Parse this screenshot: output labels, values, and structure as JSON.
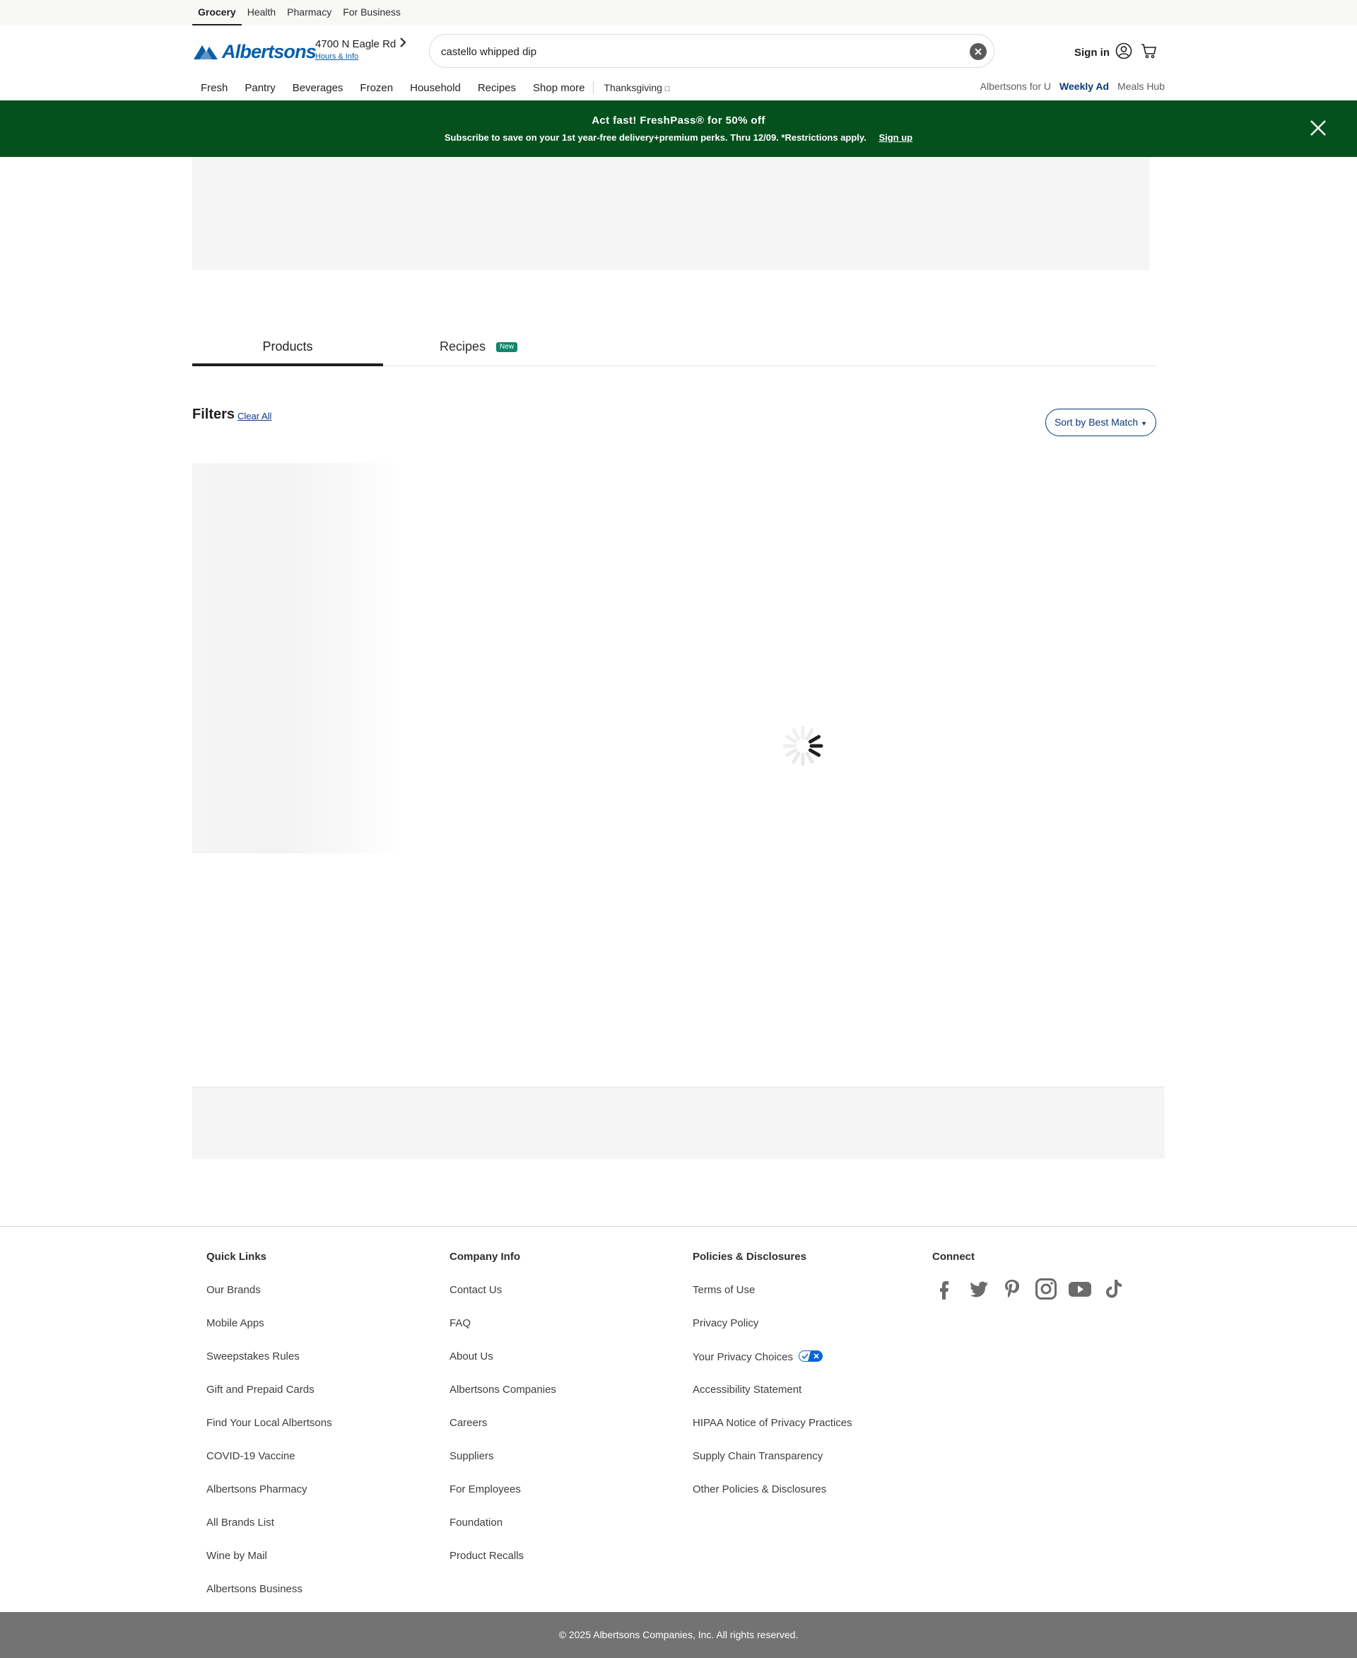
{
  "utility": {
    "tabs": [
      {
        "label": "Grocery"
      },
      {
        "label": "Health"
      },
      {
        "label": "Pharmacy"
      },
      {
        "label": "For Business"
      }
    ]
  },
  "header": {
    "brand": "Albertsons",
    "store_address": "4700 N Eagle Rd",
    "store_link": "Hours & Info",
    "search_value": "castello whipped dip",
    "signin_label": "Sign in"
  },
  "nav": {
    "items": [
      "Fresh",
      "Pantry",
      "Beverages",
      "Frozen",
      "Household",
      "Recipes",
      "Shop more"
    ],
    "seasonal": "Thanksgiving",
    "right": [
      "Albertsons for U",
      "Weekly Ad",
      "Meals Hub"
    ]
  },
  "promo": {
    "title": "Act fast! FreshPass® for 50% off",
    "subtitle": "Subscribe to save on your 1st year-free delivery+premium perks. Thru 12/09. *Restrictions apply.",
    "link": "Sign up"
  },
  "tabs": {
    "products": "Products",
    "recipes": "Recipes",
    "recipes_badge": "New"
  },
  "filters": {
    "title": "Filters",
    "clear": "Clear All",
    "sort": "Sort by Best Match"
  },
  "footer": {
    "quick_links": {
      "title": "Quick Links",
      "items": [
        "Our Brands",
        "Mobile Apps",
        "Sweepstakes Rules",
        "Gift and Prepaid Cards",
        "Find Your Local Albertsons",
        "COVID-19 Vaccine",
        "Albertsons Pharmacy",
        "All Brands List",
        "Wine by Mail",
        "Albertsons Business"
      ]
    },
    "company_info": {
      "title": "Company Info",
      "items": [
        "Contact Us",
        "FAQ",
        "About Us",
        "Albertsons Companies",
        "Careers",
        "Suppliers",
        "For Employees",
        "Foundation",
        "Product Recalls"
      ]
    },
    "policies": {
      "title": "Policies & Disclosures",
      "items": [
        "Terms of Use",
        "Privacy Policy",
        "Your Privacy Choices",
        "Accessibility Statement",
        "HIPAA Notice of Privacy Practices",
        "Supply Chain Transparency",
        "Other Policies & Disclosures"
      ]
    },
    "connect": {
      "title": "Connect",
      "icons": [
        "facebook-icon",
        "twitter-icon",
        "pinterest-icon",
        "instagram-icon",
        "youtube-icon",
        "tiktok-icon"
      ]
    },
    "copyright": "© 2025 Albertsons Companies, Inc.  All rights reserved."
  },
  "colors": {
    "brand_blue": "#0a5ea8",
    "promo_green": "#04511e",
    "link_navy": "#0a3a77",
    "badge_green": "#11866b"
  }
}
